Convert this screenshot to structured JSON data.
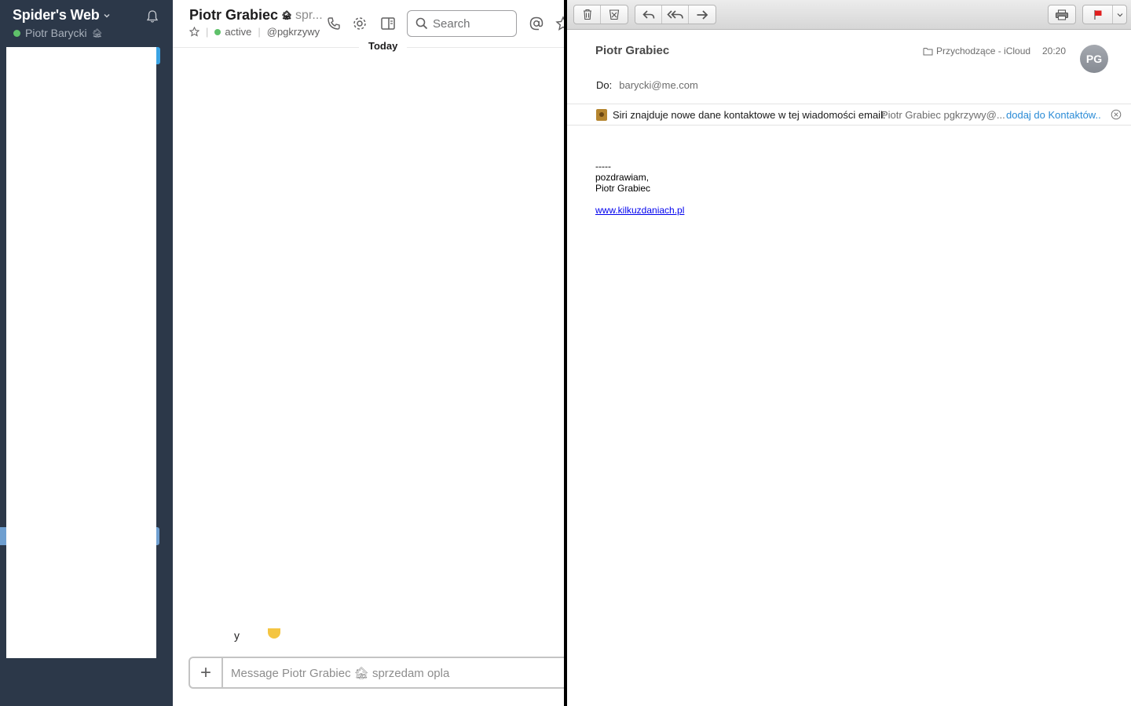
{
  "slack": {
    "team_name": "Spider's Web",
    "current_user": "Piotr Barycki",
    "channel": {
      "title": "Piotr Grabiec",
      "status_text": "spr...",
      "presence": "active",
      "handle": "@pgkrzywy",
      "search_placeholder": "Search",
      "day_divider": "Today",
      "partial_message": "y",
      "composer_placeholder": "Message Piotr Grabiec 🏚 sprzedam opla"
    }
  },
  "mail": {
    "sender": "Piotr Grabiec",
    "folder": "Przychodzące - iCloud",
    "time": "20:20",
    "avatar_initials": "PG",
    "to_label": "Do:",
    "to_address": "barycki@me.com",
    "siri_banner": {
      "text": "Siri znajduje nowe dane kontaktowe w tej wiadomości email:",
      "contact": "Piotr Grabiec pgkrzywy@...",
      "action": "dodaj do Kontaktów.."
    },
    "body": {
      "line1": "-----",
      "line2": "pozdrawiam,",
      "line3": "Piotr Grabiec",
      "link": "www.kilkuzdaniach.pl"
    }
  },
  "colors": {
    "sidebar_bg": "#2c3849",
    "presence_green": "#5fc16a",
    "link_blue": "#2a8bd6",
    "flag_red": "#e02020"
  },
  "icons": [
    "bell-icon",
    "star-icon",
    "phone-icon",
    "gear-icon",
    "sidebar-toggle-icon",
    "search-icon",
    "at-icon",
    "trash-icon",
    "junk-icon",
    "reply-icon",
    "reply-all-icon",
    "forward-icon",
    "print-icon",
    "flag-icon",
    "folder-icon",
    "close-icon"
  ]
}
